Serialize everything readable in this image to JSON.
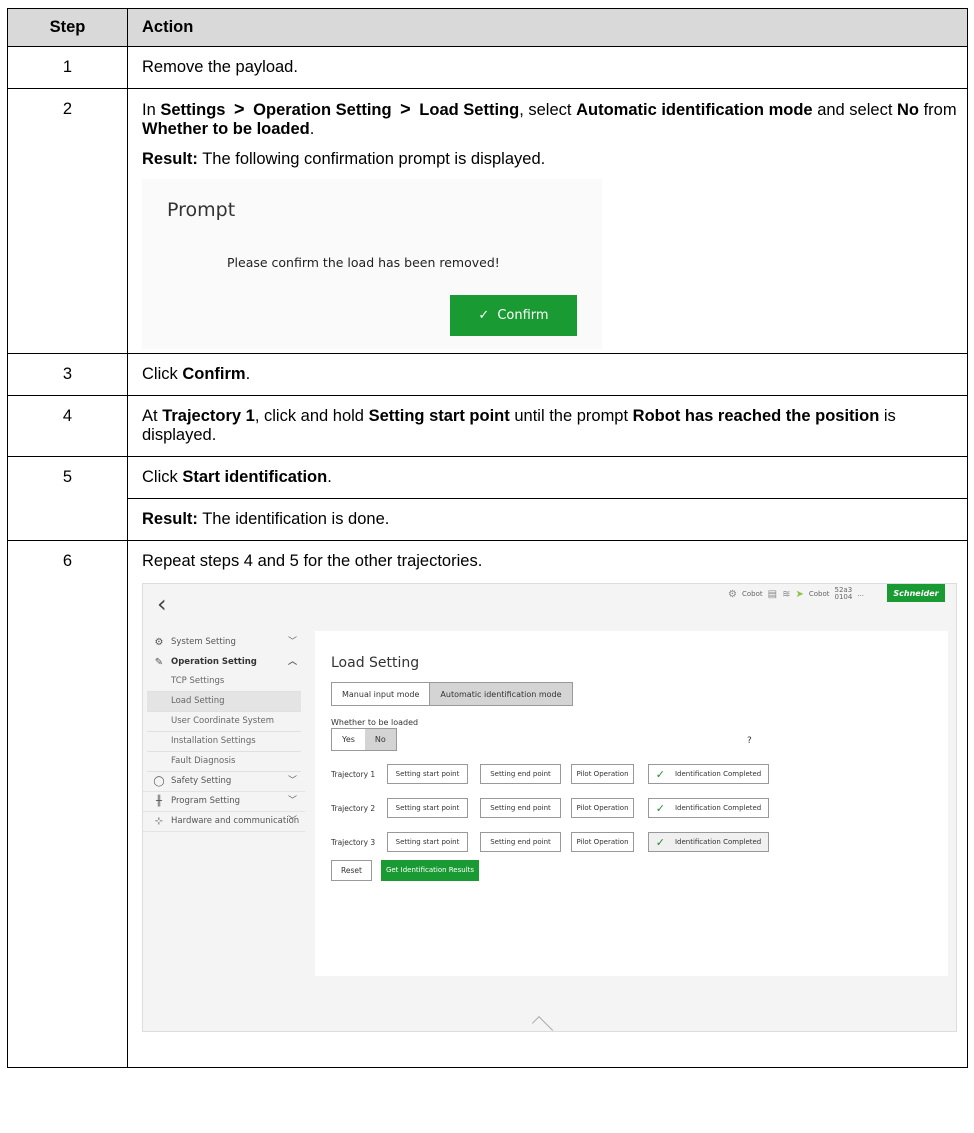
{
  "table": {
    "header_step": "Step",
    "header_action": "Action"
  },
  "steps": {
    "s1": {
      "num": "1",
      "text": "Remove the payload."
    },
    "s2": {
      "num": "2",
      "in": "In",
      "settings": "Settings",
      "arrow": ">",
      "operation_setting": "Operation Setting",
      "load_setting": "Load Setting",
      "select1": ", select",
      "auto_mode": "Automatic identification mode",
      "select2": "and select",
      "no": "No",
      "from": "from",
      "whether": "Whether to be loaded",
      "period": ".",
      "result_label": "Result:",
      "result_text": "The following confirmation prompt is displayed."
    },
    "s3": {
      "num": "3",
      "click": "Click",
      "confirm": "Confirm",
      "period": "."
    },
    "s4": {
      "num": "4",
      "at": "At",
      "trajectory1": "Trajectory 1",
      "click_hold": ", click and hold",
      "setting_start": "Setting start point",
      "until": "until the prompt",
      "reached": "Robot has reached the position",
      "displayed": "is displayed."
    },
    "s5": {
      "num": "5",
      "click": "Click",
      "start_ident": "Start identification",
      "period": ".",
      "result_label": "Result:",
      "result_text": "The identification is done."
    },
    "s6": {
      "num": "6",
      "text": "Repeat steps 4 and 5 for the other trajectories."
    }
  },
  "prompt": {
    "title": "Prompt",
    "message": "Please confirm the load has been removed!",
    "confirm_label": "Confirm",
    "check_icon": "check-icon"
  },
  "screen": {
    "status": {
      "cobot1": "Cobot",
      "cobot2": "Cobot",
      "code_top": "52a3",
      "code_bottom": "0104",
      "dots": "...",
      "brand": "Schneider"
    },
    "sidebar": {
      "system": "System Setting",
      "operation": "Operation Setting",
      "tcp": "TCP Settings",
      "load": "Load Setting",
      "ucs": "User Coordinate System",
      "install": "Installation Settings",
      "fault": "Fault Diagnosis",
      "safety": "Safety Setting",
      "program": "Program Setting",
      "hardware": "Hardware and communication"
    },
    "panel": {
      "title": "Load Setting",
      "manual_mode": "Manual input mode",
      "auto_mode": "Automatic identification mode",
      "loaded_label": "Whether to be loaded",
      "yes": "Yes",
      "no": "No",
      "help": "?",
      "trajectories": [
        {
          "label": "Trajectory 1",
          "start": "Setting start point",
          "end": "Setting end point",
          "pilot": "Pilot Operation",
          "status": "Identification Completed"
        },
        {
          "label": "Trajectory 2",
          "start": "Setting start point",
          "end": "Setting end point",
          "pilot": "Pilot Operation",
          "status": "Identification Completed"
        },
        {
          "label": "Trajectory 3",
          "start": "Setting start point",
          "end": "Setting end point",
          "pilot": "Pilot Operation",
          "status": "Identification Completed"
        }
      ],
      "reset": "Reset",
      "get_results": "Get Identification Results"
    }
  }
}
